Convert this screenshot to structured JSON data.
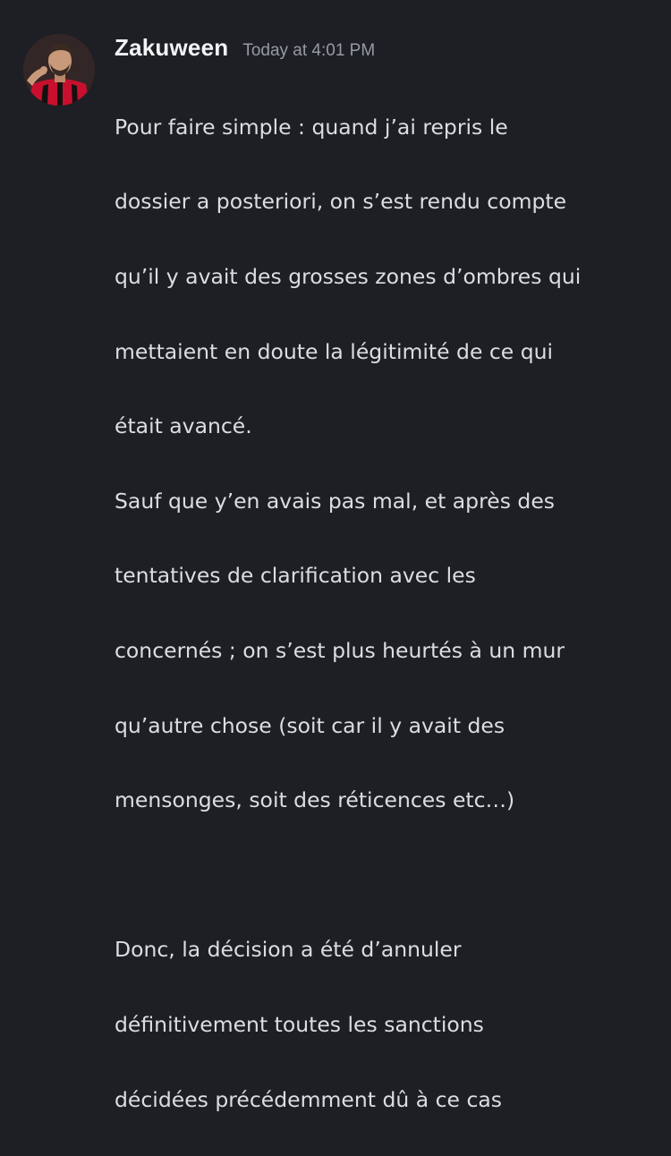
{
  "message": {
    "author": "Zakuween",
    "timestamp": "Today at 4:01 PM",
    "avatar": {
      "icon": "user-avatar-icon",
      "colors": {
        "jersey_red": "#c8102e",
        "jersey_black": "#111111",
        "skin": "#c99a7a",
        "hair": "#3a2a22",
        "bg": "#2a1f1f"
      }
    },
    "lines": [
      "Pour faire simple : quand j’ai repris le",
      "dossier a posteriori, on s’est rendu compte",
      "qu’il y avait des grosses zones d’ombres qui",
      "mettaient en doute la légitimité de ce qui",
      "était avancé.",
      "Sauf que y’en avais pas mal, et après des",
      "tentatives de clarification avec les",
      "concernés ; on s’est plus heurtés à un mur",
      "qu’autre chose (soit car il y avait des",
      "mensonges, soit des réticences etc…)",
      "",
      "Donc, la décision a été d’annuler",
      "définitivement toutes les sanctions",
      "décidées précédemment dû à ce cas"
    ]
  },
  "theme": {
    "background": "#1e1f24",
    "username_color": "#f2f3f5",
    "timestamp_color": "#949ba4",
    "text_color": "#dbdee1"
  }
}
